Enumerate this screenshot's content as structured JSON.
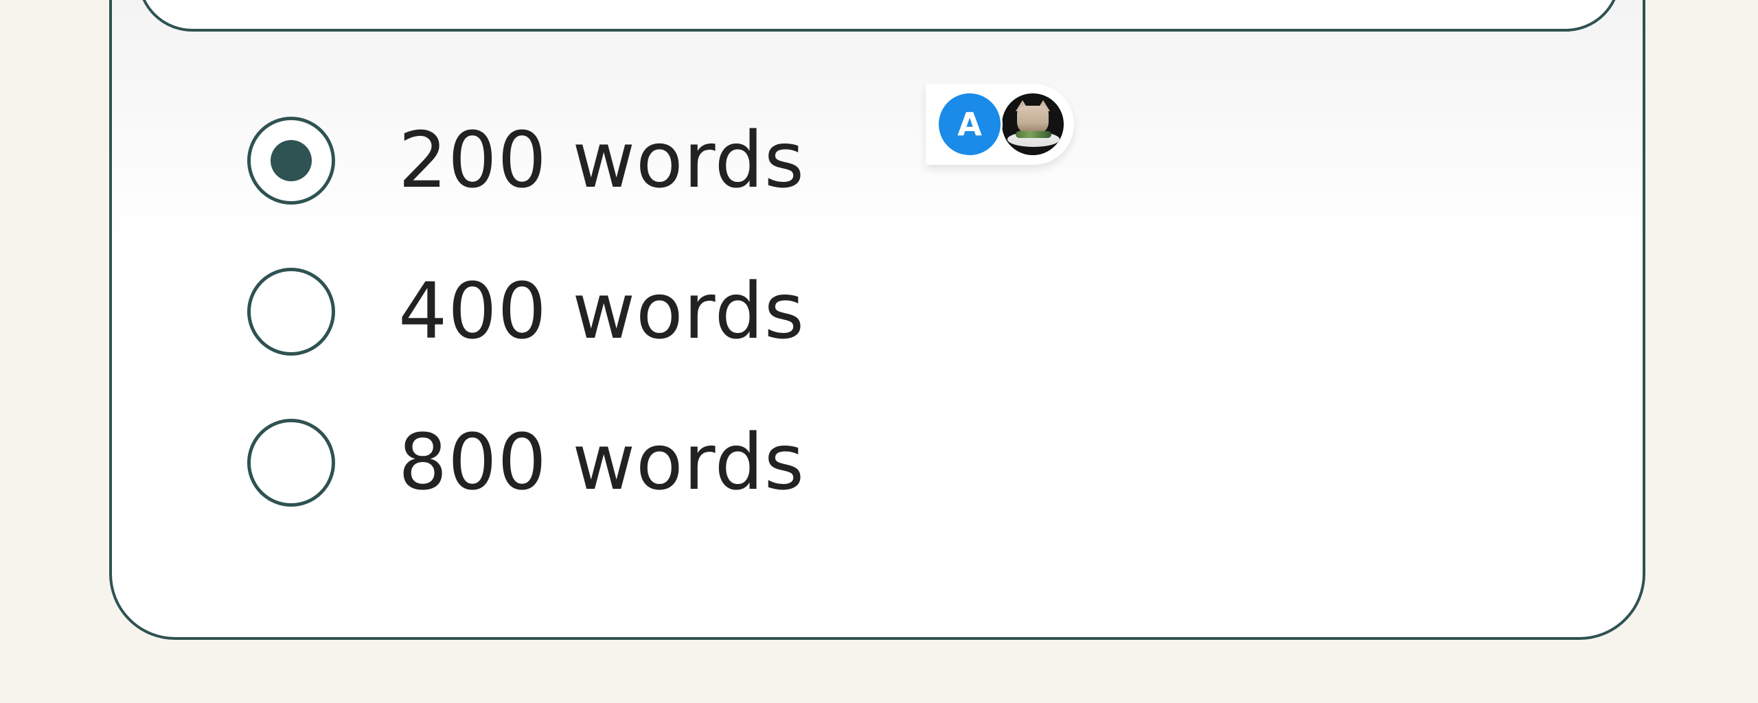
{
  "options": [
    {
      "label": "200 words",
      "selected": true
    },
    {
      "label": "400 words",
      "selected": false
    },
    {
      "label": "800 words",
      "selected": false
    }
  ],
  "avatars": [
    {
      "initial": "A",
      "color": "#1a8be8"
    },
    {
      "type": "photo",
      "icon": "cat-photo"
    }
  ],
  "colors": {
    "accent": "#2f5252",
    "background": "#f7f4ee",
    "card": "#ffffff",
    "avatar_blue": "#1a8be8"
  }
}
